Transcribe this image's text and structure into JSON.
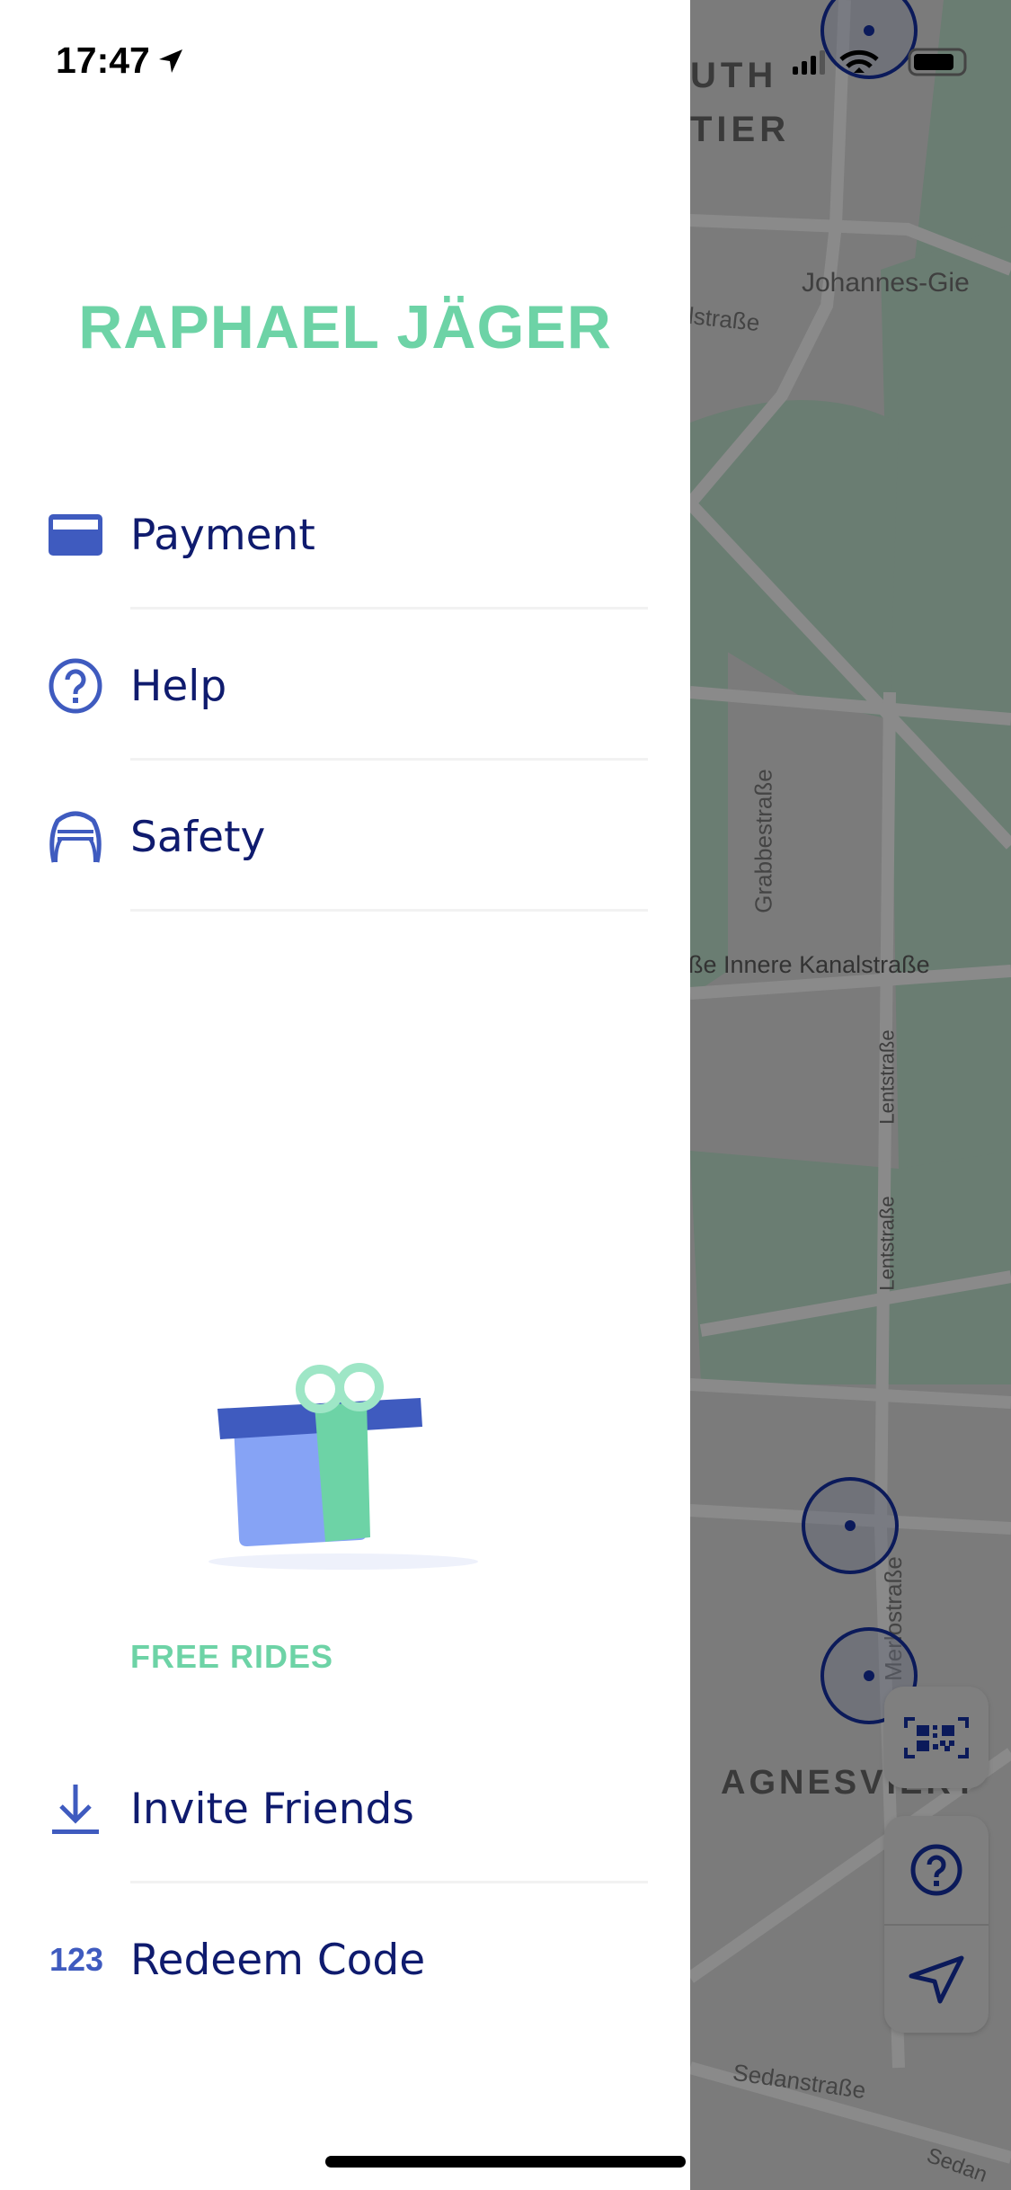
{
  "status_bar": {
    "time": "17:47",
    "location_icon": "location-arrow-icon",
    "signal_icon": "cellular-signal-icon",
    "wifi_icon": "wifi-icon",
    "battery_icon": "battery-icon"
  },
  "drawer": {
    "user_name": "RAPHAEL JÄGER",
    "menu": [
      {
        "label": "Payment",
        "icon": "credit-card-icon"
      },
      {
        "label": "Help",
        "icon": "question-circle-icon"
      },
      {
        "label": "Safety",
        "icon": "helmet-icon"
      }
    ],
    "free_rides": {
      "illustration": "gift-icon",
      "heading": "FREE RIDES",
      "items": [
        {
          "label": "Invite Friends",
          "icon": "download-icon"
        },
        {
          "label": "Redeem Code",
          "icon": "123"
        }
      ]
    }
  },
  "map": {
    "labels": {
      "district_1a": "UTH",
      "district_1b": "TIER",
      "street_johannes": "Johannes-Gie",
      "street_lstrasse": "lstraße",
      "street_grabbe": "Grabbestraße",
      "street_kanal": "ße  Innere Kanalstraße",
      "street_lent_1": "Lentstraße",
      "street_lent_2": "Lentstraße",
      "street_merlo": "Merlostraße",
      "district_2": "AGNESVIERT",
      "street_sedan_1": "Sedanstraße",
      "street_sedan_2": "Sedan"
    },
    "buttons": {
      "scan": "qr-code-icon",
      "help": "question-circle-icon",
      "locate": "navigation-arrow-icon"
    }
  },
  "colors": {
    "accent_green": "#6dd3a6",
    "navy": "#0f1b6e",
    "icon_blue": "#3f5bbf",
    "map_overlay": "#7b7b7b",
    "park": "#6a7d72"
  }
}
